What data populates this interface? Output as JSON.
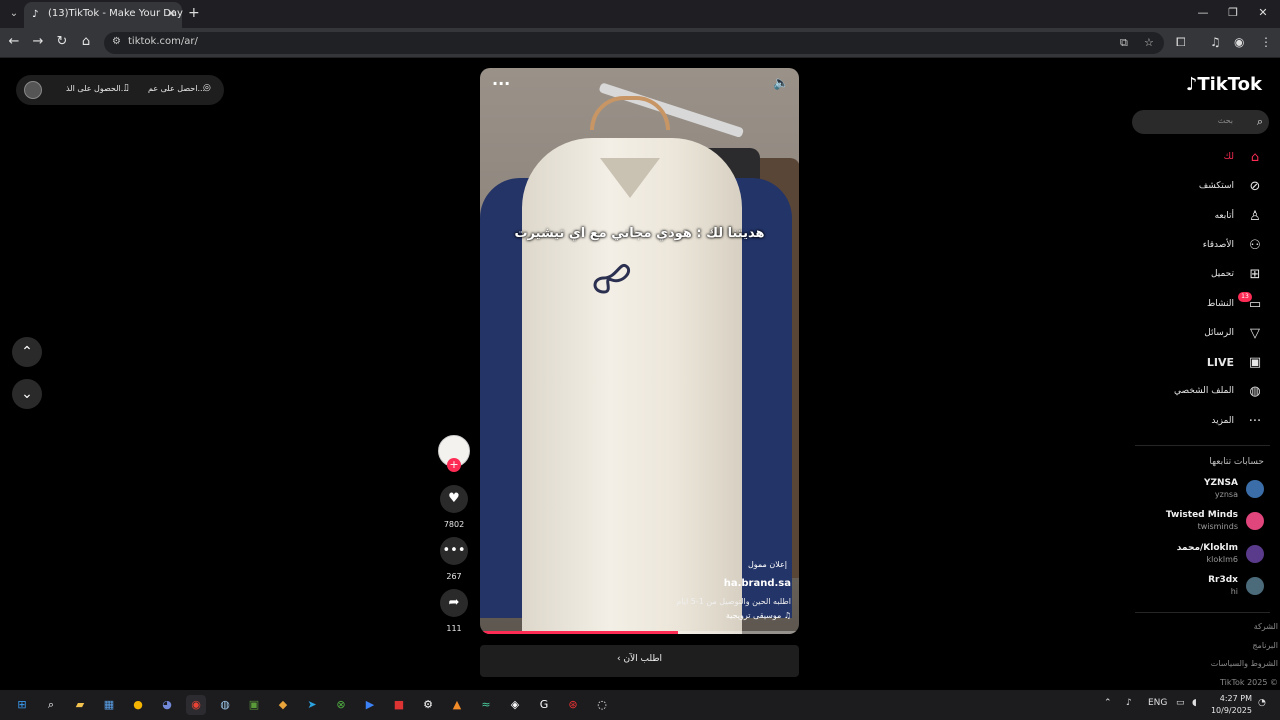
{
  "browser": {
    "tab_title": "(13)TikTok - Make Your Day",
    "url": "tiktok.com/ar/",
    "new_tab": "+",
    "tab_close": "✕"
  },
  "notification_pill": {
    "text_right": "احصل على عم...",
    "text_left": "الحصول على الذ..."
  },
  "video": {
    "caption": "هديتنا لك : هودي مجاني مع اي تيشيرت",
    "sponsored": "إعلان ممول",
    "handle": "ha.brand.sa",
    "description": "اطلبه الحين والتوصيل من 1-5 ايام",
    "music": "موسيقى ترويجية",
    "progress": 0.62
  },
  "cta": {
    "label": "اطلب الآن"
  },
  "actions": {
    "likes": "7802",
    "comments": "267",
    "shares": "111"
  },
  "sidebar": {
    "logo": "TikTok",
    "search_placeholder": "بحث",
    "items": [
      {
        "label": "لك",
        "icon": "home-icon",
        "active": true
      },
      {
        "label": "استكشف",
        "icon": "compass-icon"
      },
      {
        "label": "أتابعه",
        "icon": "following-icon"
      },
      {
        "label": "الأصدقاء",
        "icon": "friends-icon"
      },
      {
        "label": "تحميل",
        "icon": "upload-icon"
      },
      {
        "label": "النشاط",
        "icon": "activity-icon",
        "badge": "13"
      },
      {
        "label": "الرسائل",
        "icon": "messages-icon"
      },
      {
        "label": "LIVE",
        "icon": "live-icon"
      },
      {
        "label": "الملف الشخصي",
        "icon": "profile-icon"
      },
      {
        "label": "المزيد",
        "icon": "more-icon"
      }
    ],
    "following_title": "حسابات تتابعها",
    "accounts": [
      {
        "name": "YZNSA",
        "handle": "yznsa",
        "color": "#3b6ea8"
      },
      {
        "name": "Twisted Minds",
        "handle": "twisminds",
        "color": "#e0457b"
      },
      {
        "name": "محمد/Kloklm",
        "handle": "kloklm6",
        "color": "#5a3a8a"
      },
      {
        "name": "Rr3dx",
        "handle": "hi",
        "color": "#4b6b7a"
      }
    ],
    "footer": [
      "الشركة",
      "البرنامج",
      "الشروط والسياسات",
      "TikTok 2025 ©"
    ]
  },
  "taskbar": {
    "lang": "ENG",
    "time": "4:27 PM",
    "date": "10/9/2025"
  },
  "colors": {
    "accent": "#fe2c55",
    "background": "#000000"
  }
}
